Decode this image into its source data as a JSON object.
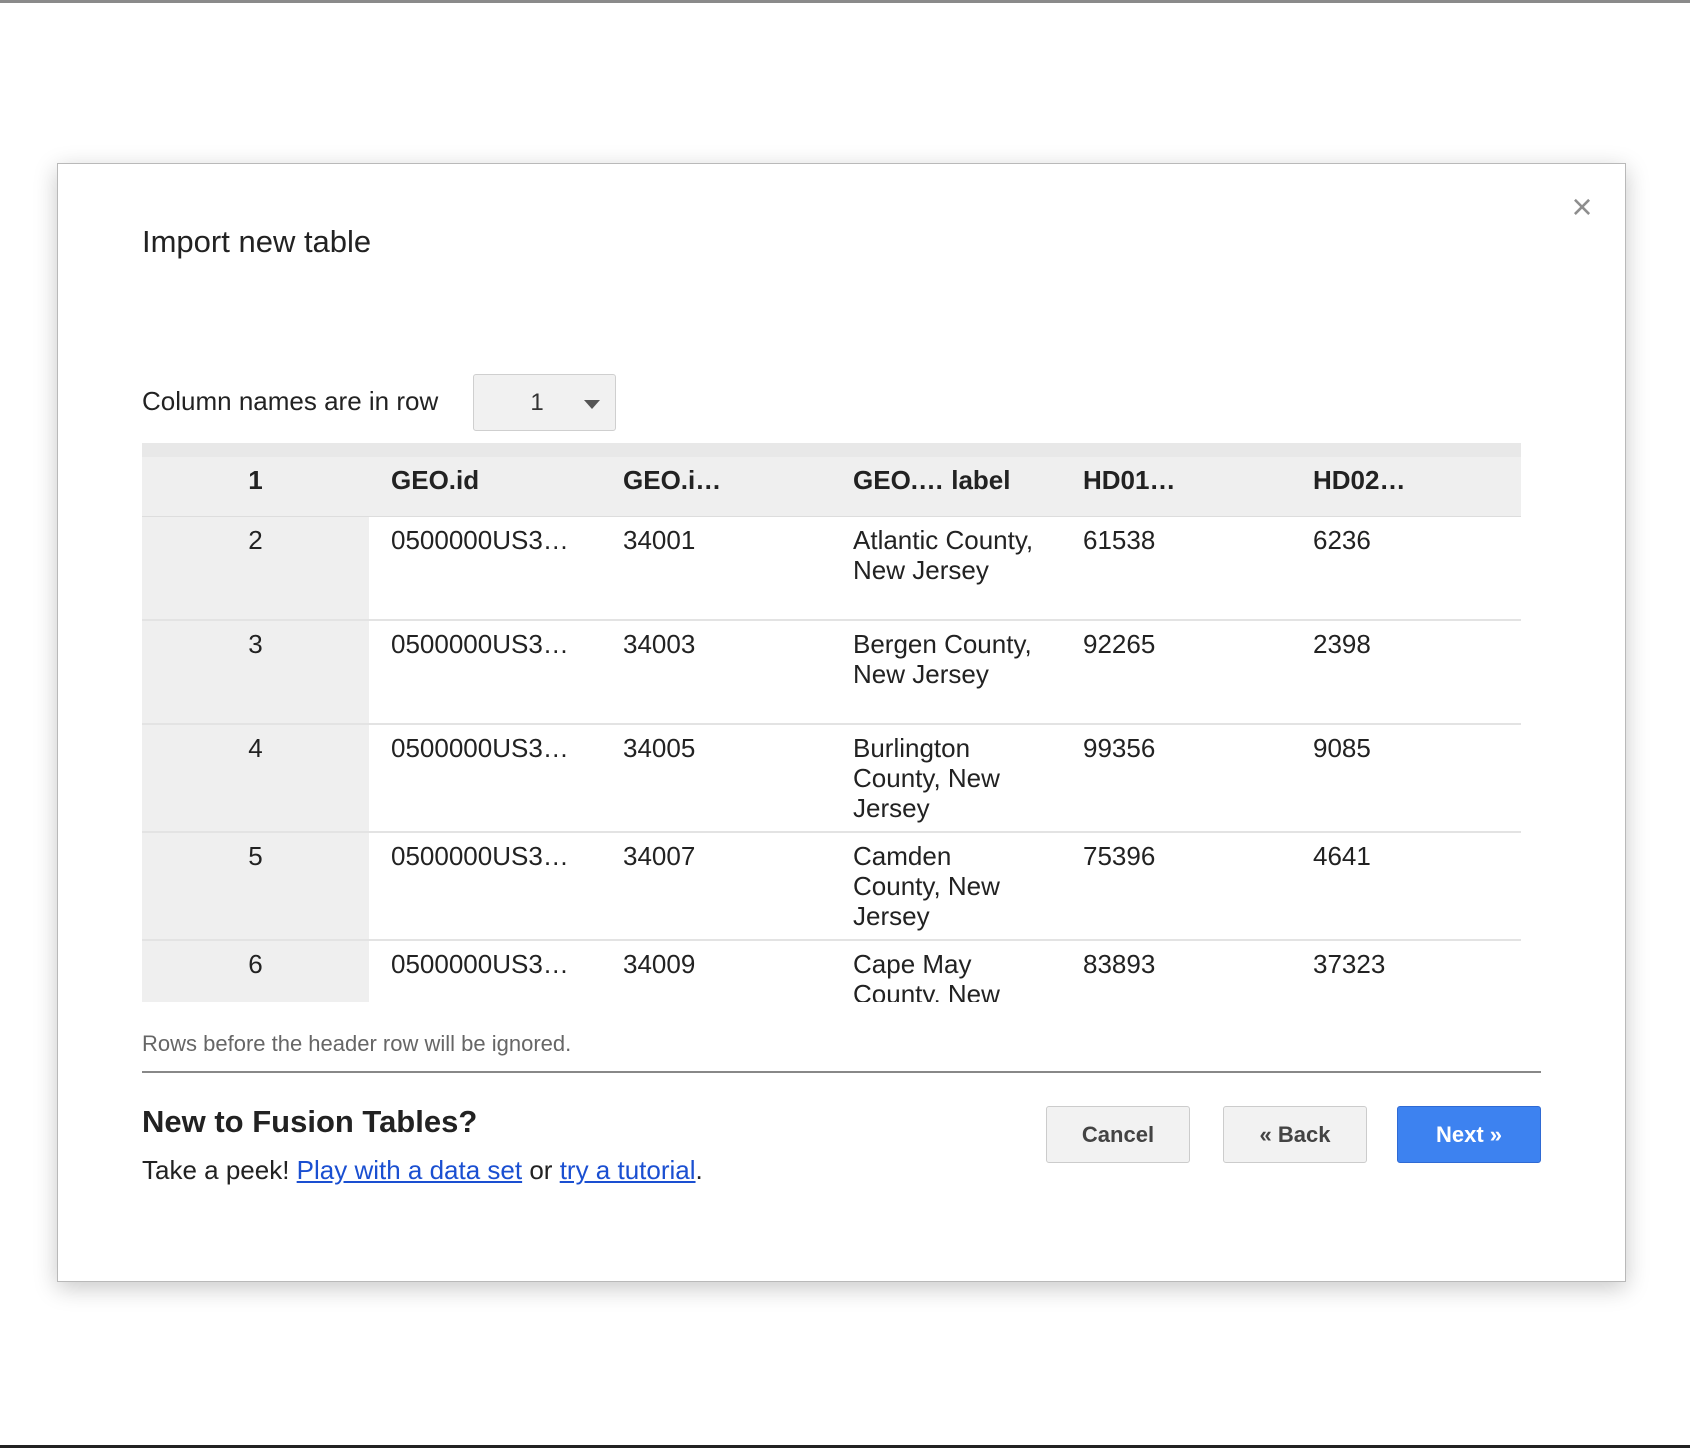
{
  "dialog": {
    "title": "Import new table",
    "close_glyph": "×"
  },
  "header_row": {
    "label": "Column names are in row",
    "selected": "1"
  },
  "table": {
    "headers": [
      "1",
      "GEO.id",
      "GEO.i…",
      "GEO.… label",
      "HD01…",
      "HD02…"
    ],
    "rows": [
      [
        "2",
        "0500000US3…",
        "34001",
        "Atlantic County, New Jersey",
        "61538",
        "6236"
      ],
      [
        "3",
        "0500000US3…",
        "34003",
        "Bergen County, New Jersey",
        "92265",
        "2398"
      ],
      [
        "4",
        "0500000US3…",
        "34005",
        "Burlington County, New Jersey",
        "99356",
        "9085"
      ],
      [
        "5",
        "0500000US3…",
        "34007",
        "Camden County, New Jersey",
        "75396",
        "4641"
      ],
      [
        "6",
        "0500000US3…",
        "34009",
        "Cape May County, New Jersey",
        "83893",
        "37323"
      ]
    ]
  },
  "hint": "Rows before the header row will be ignored.",
  "promo": {
    "title": "New to Fusion Tables?",
    "prefix": "Take a peek! ",
    "link1": "Play with a data set",
    "middle": " or ",
    "link2": "try a tutorial",
    "suffix": "."
  },
  "buttons": {
    "cancel": "Cancel",
    "back": "« Back",
    "next": "Next »"
  },
  "colors": {
    "primary_button": "#3d82f0",
    "link": "#1a4fd1",
    "table_header_bg": "#efefef"
  },
  "icons": {
    "close": "close-icon",
    "dropdown": "chevron-down-icon"
  }
}
